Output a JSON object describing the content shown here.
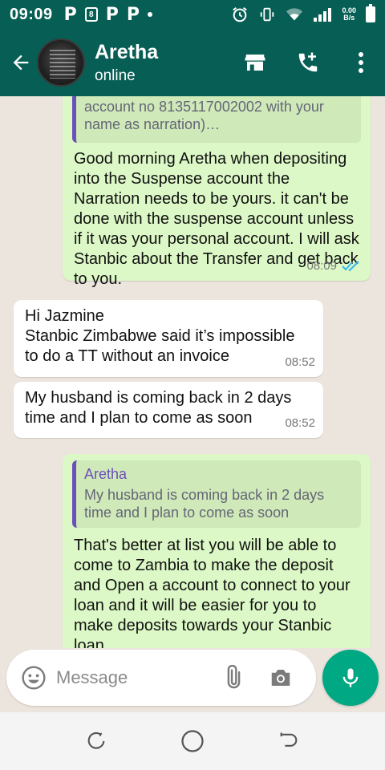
{
  "status_bar": {
    "time": "09:09",
    "left_icons": [
      "P",
      "P",
      "P"
    ],
    "net_speed_value": "0.00",
    "net_speed_unit": "B/s"
  },
  "header": {
    "contact_name": "Aretha",
    "contact_status": "online"
  },
  "messages": [
    {
      "direction": "outgoing",
      "quote_text_line1": "account no 8135117002002 with your",
      "quote_text_line2": "name as narration)…",
      "text": "Good morning Aretha when depositing into the Suspense account the Narration needs to be yours. it can't be done with the suspense account unless if it was your personal account. I will ask Stanbic about the Transfer and get back to you.",
      "time": "08:09",
      "status": "read"
    },
    {
      "direction": "incoming",
      "text_line1": "Hi Jazmine",
      "text_line2": "Stanbic Zimbabwe said it’s impossible",
      "text_line3": "to do a TT without an invoice",
      "time": "08:52"
    },
    {
      "direction": "incoming",
      "text_line1": "My husband is coming back in 2 days",
      "text_line2": "time and I plan to come as soon",
      "time": "08:52"
    },
    {
      "direction": "outgoing",
      "quote_author": "Aretha",
      "quote_text_line1": "My husband is coming back in 2 days",
      "quote_text_line2": "time and I plan to come as soon",
      "text": "That's better at list you will be able to come to Zambia to make the deposit and Open a account to connect to your loan and it will be easier for you to make deposits towards your Stanbic loan"
    }
  ],
  "composer": {
    "placeholder": "Message"
  },
  "colors": {
    "header": "#075e54",
    "outgoing_bubble": "#dcf8c6",
    "incoming_bubble": "#ffffff",
    "accent": "#00a884",
    "read_tick": "#34b7f1",
    "quote_bar": "#6b4fbb"
  }
}
